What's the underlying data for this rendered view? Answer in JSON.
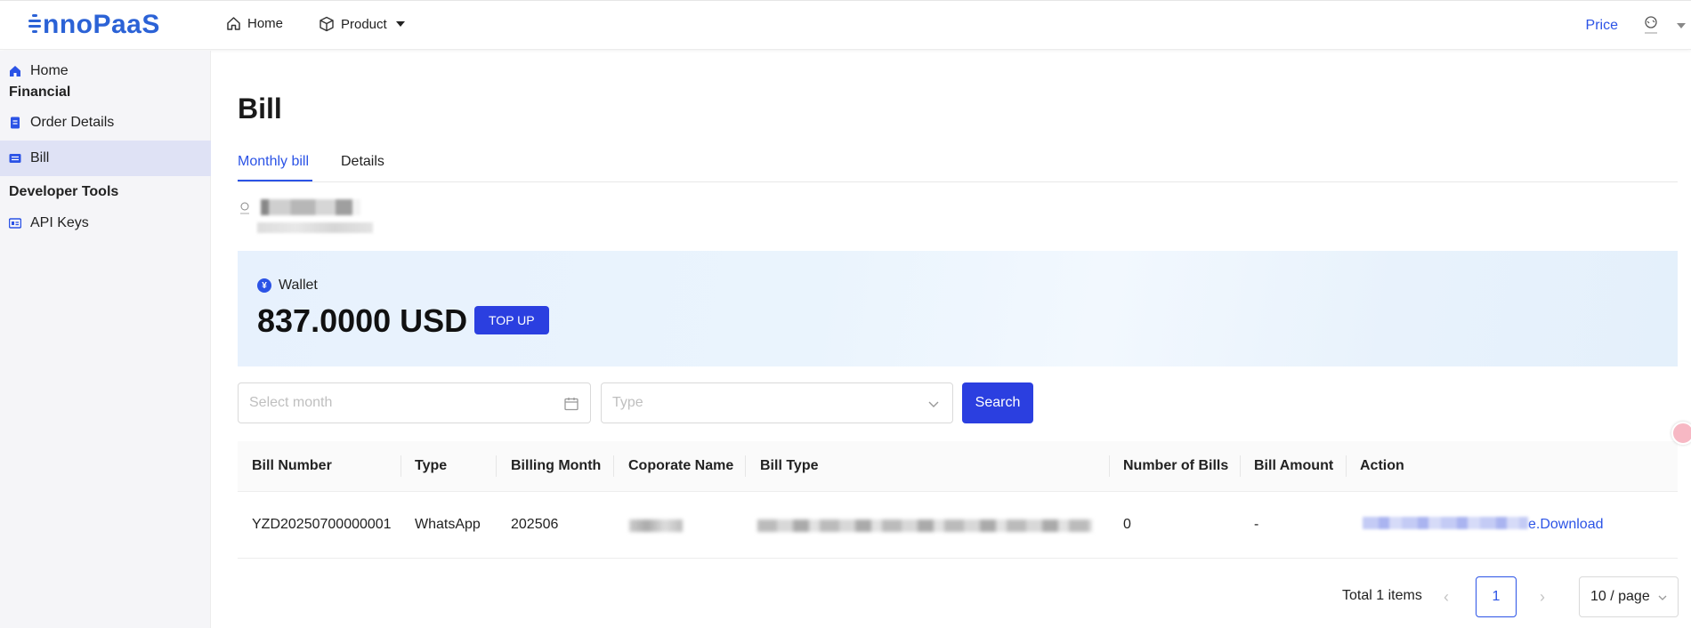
{
  "header": {
    "logo_text": "nnoPaaS",
    "nav": {
      "home": "Home",
      "product": "Product"
    },
    "price": "Price"
  },
  "sidebar": {
    "home": "Home",
    "group_financial": "Financial",
    "order_details": "Order Details",
    "bill": "Bill",
    "group_developer": "Developer Tools",
    "api_keys": "API Keys"
  },
  "page": {
    "title": "Bill",
    "tabs": [
      "Monthly bill",
      "Details"
    ],
    "active_tab": "Monthly bill"
  },
  "wallet": {
    "label": "Wallet",
    "amount": "837.0000 USD",
    "top_up": "TOP UP"
  },
  "filters": {
    "month_placeholder": "Select month",
    "type_placeholder": "Type",
    "search": "Search"
  },
  "table": {
    "columns": [
      "Bill Number",
      "Type",
      "Billing Month",
      "Coporate Name",
      "Bill Type",
      "Number of Bills",
      "Bill Amount",
      "Action"
    ],
    "rows": [
      {
        "bill_number": "YZD20250700000001",
        "type": "WhatsApp",
        "billing_month": "202506",
        "number_of_bills": "0",
        "bill_amount": "-",
        "action_suffix": "e.Download"
      }
    ]
  },
  "pagination": {
    "total": "Total 1 items",
    "current_page": "1",
    "page_size": "10 / page"
  },
  "colors": {
    "accent": "#2b53e6",
    "button": "#2b3fe0",
    "logo": "#2b62d6",
    "sidebar_active": "#dfe2f5"
  }
}
